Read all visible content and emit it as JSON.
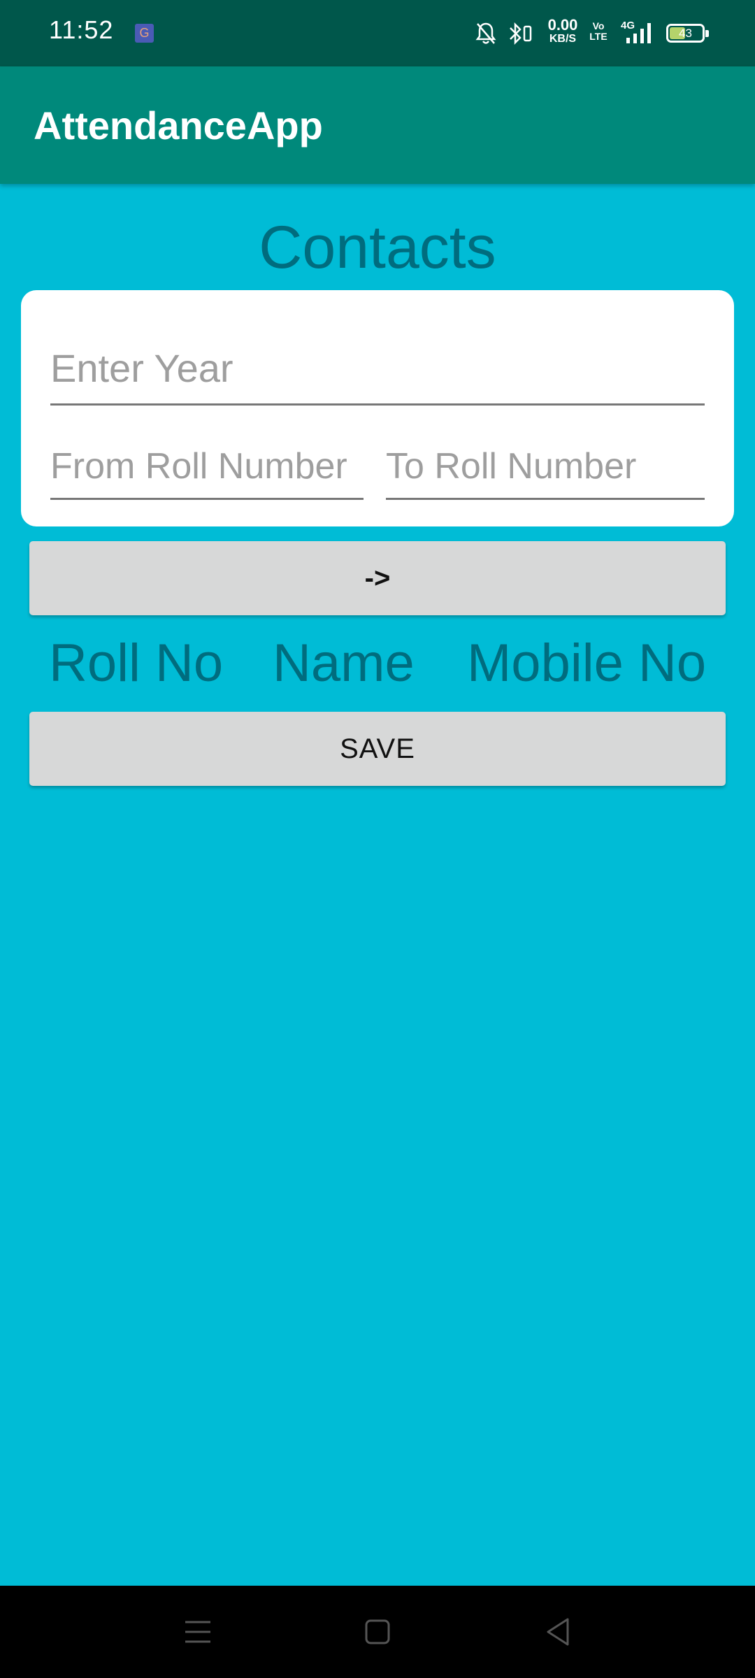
{
  "status_bar": {
    "time": "11:52",
    "app_icon": "g-app-icon",
    "net_speed_value": "0.00",
    "net_speed_unit": "KB/S",
    "volte_line1": "Vo",
    "volte_line2": "LTE",
    "network_type": "4G",
    "battery": "43",
    "icons": [
      "mute-bell-icon",
      "bluetooth-icon",
      "signal-icon",
      "battery-icon"
    ]
  },
  "app_bar": {
    "title": "AttendanceApp"
  },
  "page": {
    "title": "Contacts"
  },
  "form": {
    "year_placeholder": "Enter Year",
    "from_roll_placeholder": "From Roll Number",
    "to_roll_placeholder": "To Roll Number",
    "go_button_label": "->"
  },
  "table": {
    "headers": [
      "Roll No",
      "Name",
      "Mobile No"
    ]
  },
  "actions": {
    "save_label": "SAVE"
  },
  "nav_bar": {
    "icons": [
      "menu-icon",
      "home-icon",
      "back-icon"
    ]
  },
  "colors": {
    "status_bar": "#00574B",
    "app_bar": "#00897B",
    "background": "#00BCD6",
    "heading_text": "#006C7E",
    "button": "#D7D8D8"
  }
}
